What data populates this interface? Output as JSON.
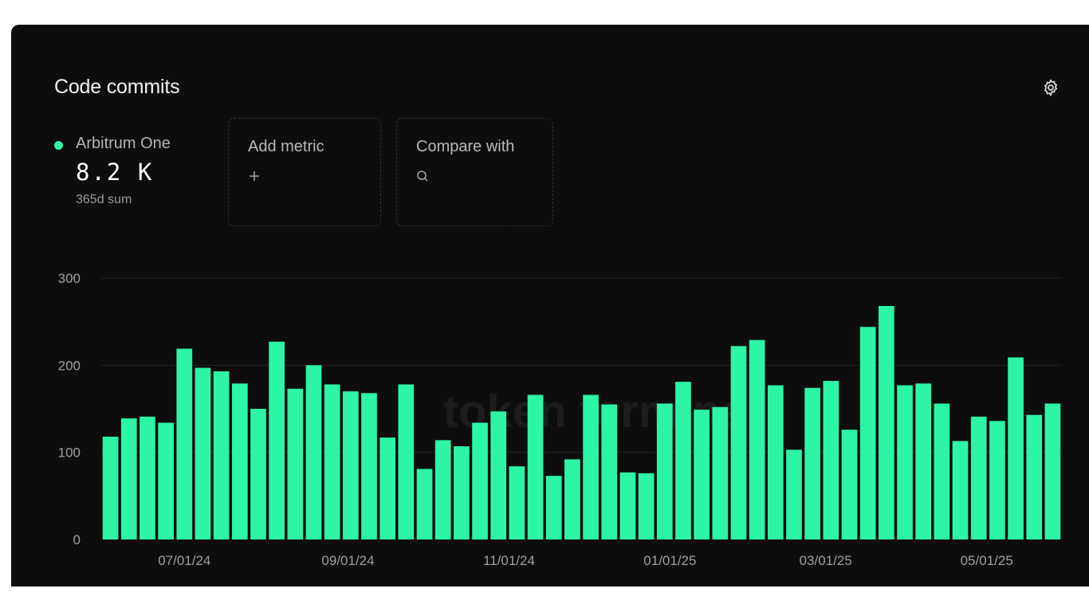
{
  "card": {
    "title": "Code commits",
    "settings_icon": "gear-icon"
  },
  "series_summary": {
    "name": "Arbitrum One",
    "value": "8.2 K",
    "subtitle": "365d sum",
    "color": "#2cf5a5"
  },
  "add_metric": {
    "label": "Add metric",
    "icon": "plus-icon"
  },
  "compare": {
    "label": "Compare with",
    "icon": "search-icon"
  },
  "watermark": "token terminal",
  "chart_data": {
    "type": "bar",
    "x": [
      "2024-06-03",
      "2024-06-10",
      "2024-06-17",
      "2024-06-24",
      "2024-07-01",
      "2024-07-08",
      "2024-07-15",
      "2024-07-22",
      "2024-07-29",
      "2024-08-05",
      "2024-08-12",
      "2024-08-19",
      "2024-08-26",
      "2024-09-02",
      "2024-09-09",
      "2024-09-16",
      "2024-09-23",
      "2024-09-30",
      "2024-10-07",
      "2024-10-14",
      "2024-10-21",
      "2024-10-28",
      "2024-11-04",
      "2024-11-11",
      "2024-11-18",
      "2024-11-25",
      "2024-12-02",
      "2024-12-09",
      "2024-12-16",
      "2024-12-23",
      "2024-12-30",
      "2025-01-06",
      "2025-01-13",
      "2025-01-20",
      "2025-01-27",
      "2025-02-03",
      "2025-02-10",
      "2025-02-17",
      "2025-02-24",
      "2025-03-03",
      "2025-03-10",
      "2025-03-17",
      "2025-03-24",
      "2025-03-31",
      "2025-04-07",
      "2025-04-14",
      "2025-04-21",
      "2025-04-28",
      "2025-05-05",
      "2025-05-12",
      "2025-05-19",
      "2025-05-26",
      "2025-06-02"
    ],
    "values": [
      118,
      139,
      141,
      134,
      219,
      197,
      193,
      179,
      150,
      227,
      173,
      200,
      178,
      170,
      168,
      117,
      178,
      81,
      114,
      107,
      134,
      147,
      84,
      166,
      73,
      92,
      166,
      155,
      77,
      76,
      156,
      181,
      149,
      152,
      222,
      229,
      177,
      103,
      174,
      182,
      126,
      244,
      268,
      177,
      179,
      156,
      113,
      141,
      136,
      209,
      143,
      156
    ],
    "series": [
      {
        "name": "Arbitrum One",
        "color": "#2cf5a5"
      }
    ],
    "yticks": [
      0,
      100,
      200,
      300
    ],
    "ylim": [
      0,
      300
    ],
    "xtick_labels": [
      "07/01/24",
      "09/01/24",
      "11/01/24",
      "01/01/25",
      "03/01/25",
      "05/01/25"
    ],
    "xtick_dates": [
      "2024-07-01",
      "2024-09-01",
      "2024-11-01",
      "2025-01-01",
      "2025-03-01",
      "2025-05-01"
    ],
    "grid": true,
    "title": "Code commits"
  }
}
